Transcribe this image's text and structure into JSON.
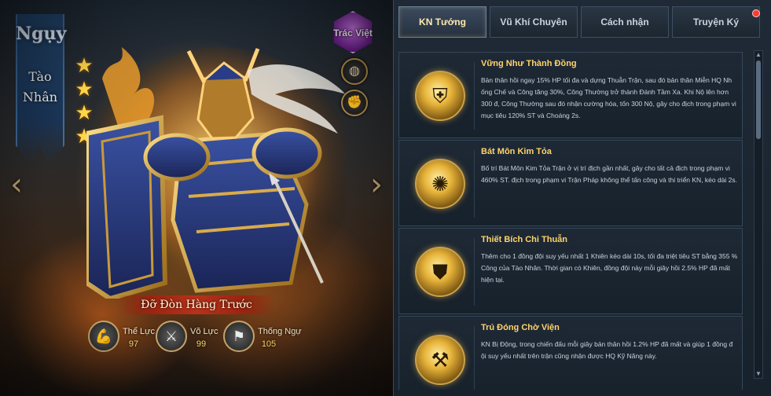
{
  "hero": {
    "faction": "Ngụy",
    "name_line1": "Tào",
    "name_line2": "Nhân",
    "stars": 4,
    "clan_badge": "Trác Việt",
    "role": "Đỡ Đòn Hàng Trước",
    "stats": [
      {
        "label": "Thể Lực",
        "value": "97",
        "icon": "muscle-icon"
      },
      {
        "label": "Võ Lực",
        "value": "99",
        "icon": "crossed-swords-icon"
      },
      {
        "label": "Thống Ngự",
        "value": "105",
        "icon": "banner-icon"
      }
    ],
    "side_buttons": [
      "shield-icon",
      "fist-icon"
    ],
    "nav": {
      "prev": "‹",
      "next": "›"
    }
  },
  "tabs": [
    {
      "label": "KN Tướng",
      "active": true
    },
    {
      "label": "Vũ Khí Chuyên",
      "active": false
    },
    {
      "label": "Cách nhận",
      "active": false
    },
    {
      "label": "Truyện Ký",
      "active": false
    }
  ],
  "skills": [
    {
      "title": "Vững Như Thành Đồng",
      "desc": "Bản thân hồi ngay 15% HP tối đa và dựng Thuẫn Trận, sau đó bản thân Miễn HQ Nh ống Chế và Công tăng 30%, Công Thường trở thành Đánh Tầm Xa. Khi Nộ lên hơn 300 đ, Công Thường sau đó nhận cường hóa, tốn 300 Nộ, gây cho địch trong phạm vi mục tiêu 120% ST và Choáng 2s.",
      "icon": "shield-barrier-icon"
    },
    {
      "title": "Bát Môn Kim Tỏa",
      "desc": "Bố trí Bát Môn Kim Tỏa Trận ở vị trí địch gần nhất, gây cho tất cả địch trong phạm vi 460% ST. địch trong phạm vi Trận Pháp không thể tấn công và thi triển KN, kéo dài 2s.",
      "icon": "golden-lock-icon"
    },
    {
      "title": "Thiết Bích Chi Thuẫn",
      "desc": "Thêm cho 1 đồng đội suy yếu nhất 1 Khiên kéo dài 10s, tối đa triệt tiêu ST bằng 355 % Công của Tào Nhân. Thời gian có Khiên, đồng đội này mỗi giây hồi 2.5% HP đã mất hiện tại.",
      "icon": "golden-shield-icon"
    },
    {
      "title": "Trú Đóng Chờ Viện",
      "desc": "KN Bị Động, trong chiến đấu mỗi giây bản thân hồi 1.2% HP đã mất và giúp 1 đồng đ ội suy yếu nhất trên trận cũng nhận được HQ Kỹ Năng này.",
      "icon": "hammer-warrior-icon"
    }
  ],
  "colors": {
    "accent": "#ffd36b",
    "faction_blue": "#23476f",
    "badge_purple": "#8e2ab5"
  }
}
